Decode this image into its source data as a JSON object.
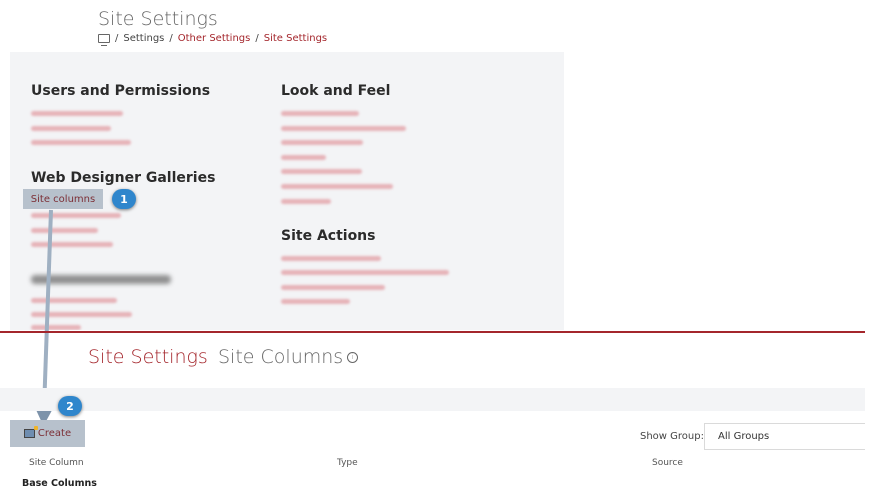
{
  "top_page": {
    "title": "Site Settings",
    "breadcrumb": [
      "Settings",
      "Other Settings",
      "Site Settings"
    ],
    "sections": {
      "users_permissions": "Users and Permissions",
      "look_feel": "Look and Feel",
      "web_designer_galleries": "Web Designer Galleries",
      "site_actions": "Site Actions"
    },
    "highlighted_link": "Site columns"
  },
  "bottom_page": {
    "breadcrumb_parent": "Site Settings",
    "breadcrumb_current": "Site Columns",
    "create_label": "Create",
    "show_group_label": "Show Group:",
    "show_group_value": "All Groups",
    "columns": [
      "Site Column",
      "Type",
      "Source"
    ],
    "group_heading": "Base Columns"
  },
  "callouts": [
    "1",
    "2"
  ],
  "colors": {
    "accent": "#a4262c",
    "callout": "#2f86cc",
    "highlight": "#b7c1cc",
    "panel": "#f3f4f6"
  }
}
